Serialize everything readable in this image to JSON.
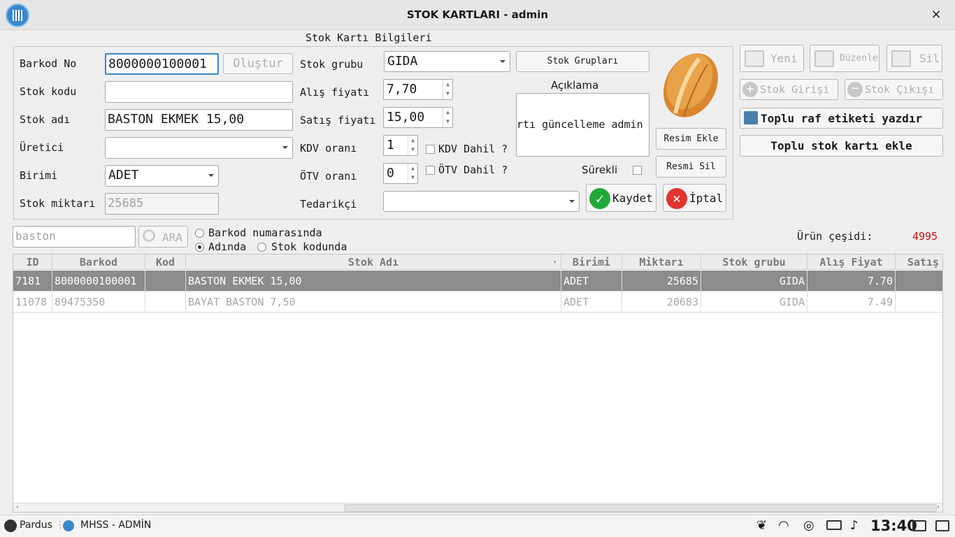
{
  "window": {
    "title": "STOK KARTLARI - admin",
    "close": "×"
  },
  "form": {
    "group_title": "Stok Kartı Bilgileri",
    "barcode": {
      "label": "Barkod No",
      "value": "8000000100001",
      "generate": "Oluştur"
    },
    "code": {
      "label": "Stok kodu",
      "value": ""
    },
    "name": {
      "label": "Stok adı",
      "value": "BASTON EKMEK 15,00"
    },
    "producer": {
      "label": "Üretici",
      "value": ""
    },
    "unit": {
      "label": "Birimi",
      "value": "ADET"
    },
    "quantity": {
      "label": "Stok miktarı",
      "value": "25685"
    },
    "group": {
      "label": "Stok grubu",
      "value": "GIDA",
      "button": "Stok Grupları"
    },
    "buy_price": {
      "label": "Alış fiyatı",
      "value": "7,70"
    },
    "sell_price": {
      "label": "Satış fiyatı",
      "value": "15,00"
    },
    "vat": {
      "label": "KDV oranı",
      "value": "1",
      "included": "KDV Dahil ?"
    },
    "otv": {
      "label": "ÖTV oranı",
      "value": "0",
      "included": "ÖTV Dahil ?"
    },
    "supplier": {
      "label": "Tedarikçi",
      "value": ""
    },
    "description": {
      "label": "Açıklama",
      "value": "rtı güncelleme admin"
    },
    "continuous": {
      "label": "Sürekli"
    },
    "image_add": "Resim Ekle",
    "image_remove": "Resmi Sil",
    "save": "Kaydet",
    "cancel": "İptal"
  },
  "actions": {
    "new": "Yeni",
    "edit": "Düzenle",
    "delete": "Sil",
    "stock_in": "Stok Girişi",
    "stock_out": "Stok Çıkışı",
    "print_labels": "Toplu raf etiketi yazdır",
    "bulk_add": "Toplu stok kartı ekle"
  },
  "search": {
    "value": "baston",
    "button": "ARA",
    "options": [
      "Barkod numarasında",
      "Adında",
      "Stok kodunda"
    ],
    "selected": "Adında",
    "count_label": "Ürün çeşidi:",
    "count_value": "4995"
  },
  "table": {
    "columns": [
      "ID",
      "Barkod",
      "Kod",
      "Stok Adı",
      "Birimi",
      "Miktarı",
      "Stok grubu",
      "Alış Fiyat",
      "Satış"
    ],
    "rows": [
      {
        "id": "7181",
        "barcode": "8000000100001",
        "code": "",
        "name": "BASTON EKMEK 15,00",
        "unit": "ADET",
        "qty": "25685",
        "group": "GIDA",
        "buy": "7.70",
        "sell": ""
      },
      {
        "id": "11078",
        "barcode": "89475350",
        "code": "",
        "name": "BAYAT BASTON 7,50",
        "unit": "ADET",
        "qty": "20683",
        "group": "GIDA",
        "buy": "7.49",
        "sell": ""
      }
    ]
  },
  "taskbar": {
    "menu": "Pardus",
    "app": "MHSS - ADMİN",
    "time": "13:40"
  },
  "colors": {
    "accent": "#3b87c9",
    "count": "#d01010",
    "selected_row": "#8c8c8c",
    "save_icon": "#22a83a",
    "cancel_icon": "#e3342f"
  }
}
